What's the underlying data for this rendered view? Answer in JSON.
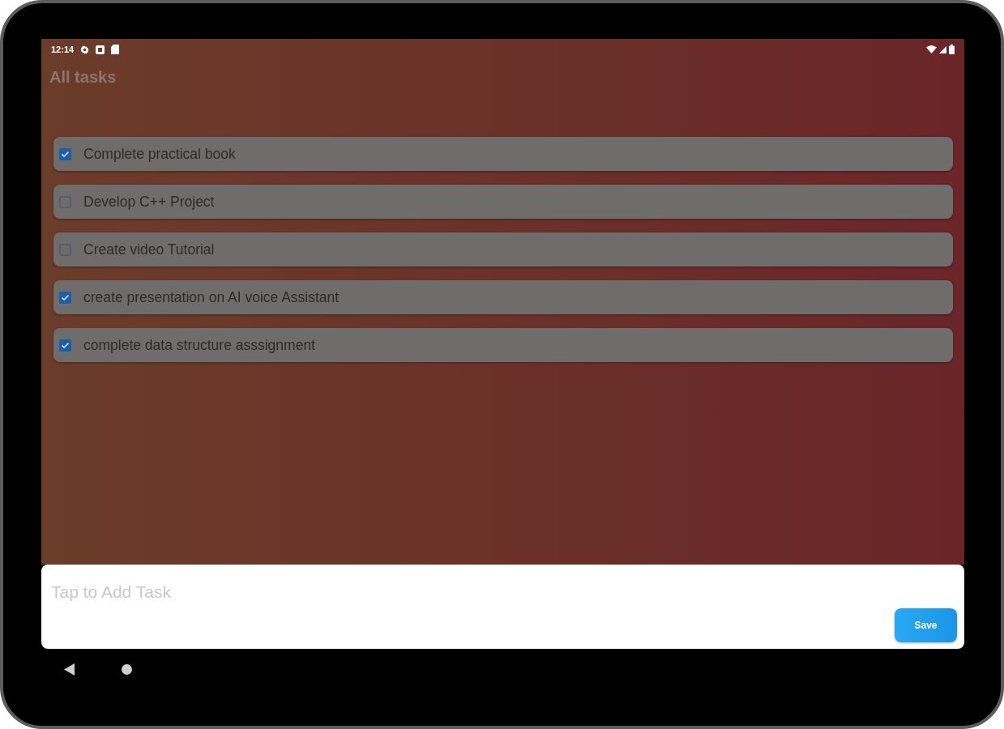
{
  "status_bar": {
    "time": "12:14"
  },
  "title": "All tasks",
  "tasks": [
    {
      "label": "Complete practical book",
      "checked": true
    },
    {
      "label": "Develop C++ Project",
      "checked": false
    },
    {
      "label": "Create video Tutorial",
      "checked": false
    },
    {
      "label": "create presentation on AI voice Assistant",
      "checked": true
    },
    {
      "label": "complete data structure asssignment",
      "checked": true
    }
  ],
  "new_task": {
    "placeholder": "Tap to Add Task"
  },
  "save_button": {
    "label": "Save"
  }
}
